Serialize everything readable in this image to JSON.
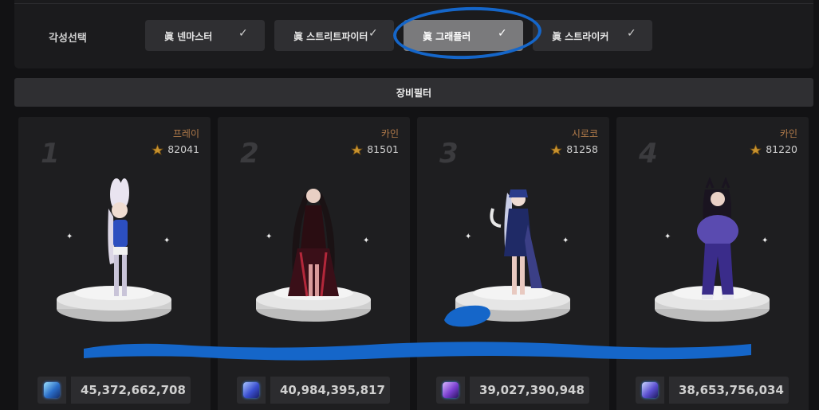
{
  "awakening": {
    "label": "각성선택",
    "options": [
      {
        "label": "眞 넨마스터",
        "check": "✓",
        "active": false
      },
      {
        "label": "眞 스트리트파이터",
        "check": "✓",
        "active": false
      },
      {
        "label": "眞 그래플러",
        "check": "✓",
        "active": true
      },
      {
        "label": "眞 스트라이커",
        "check": "✓",
        "active": false
      }
    ]
  },
  "filter": {
    "label": "장비필터"
  },
  "rankings": [
    {
      "rank": "1",
      "server": "프레이",
      "fame": "82041",
      "power": "45,372,662,708"
    },
    {
      "rank": "2",
      "server": "카인",
      "fame": "81501",
      "power": "40,984,395,817"
    },
    {
      "rank": "3",
      "server": "시로코",
      "fame": "81258",
      "power": "39,027,390,948"
    },
    {
      "rank": "4",
      "server": "카인",
      "fame": "81220",
      "power": "38,653,756,034"
    }
  ],
  "icons": {
    "fame": "fame-emblem-icon",
    "power": "power-crystal-icon",
    "check": "check-icon"
  },
  "colors": {
    "annotation": "#1566c9",
    "server_text": "#b07a4a",
    "active_option": "#7a7a7c"
  }
}
